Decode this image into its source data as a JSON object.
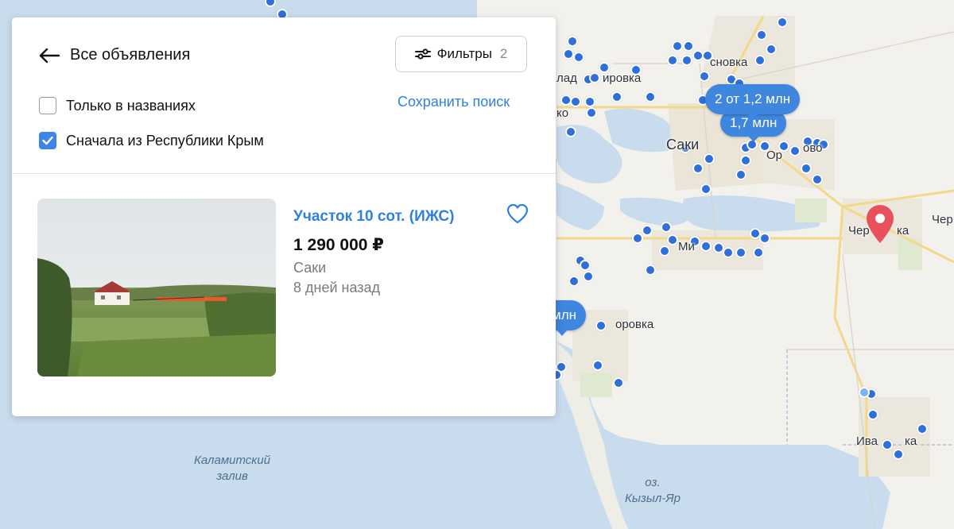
{
  "panel": {
    "back_label": "Все объявления",
    "filters": {
      "label": "Фильтры",
      "count": "2"
    },
    "checkbox_names_only": {
      "label": "Только в названиях",
      "checked": false
    },
    "checkbox_crimea_first": {
      "label": "Сначала из Республики Крым",
      "checked": true
    },
    "save_search_label": "Сохранить поиск"
  },
  "listing": {
    "title": "Участок 10 сот. (ИЖС)",
    "price": "1 290 000 ₽",
    "location": "Саки",
    "age": "8 дней назад"
  },
  "map": {
    "labels": {
      "saki": "Саки",
      "lesnovka": "сновка",
      "vladimirovka_left": "лад",
      "vladimirovka_right": "ировка",
      "orekhovo": "Ор",
      "orekhovo_tail": "ово",
      "chernovka": "Чер",
      "chernovka_right": "ка",
      "cher_far": "Чер",
      "mikhailovka": "Ми",
      "fedorovka": "оровка",
      "ivanovka": "Ива",
      "ivanovka_tail": "ка",
      "ko": "ко"
    },
    "water": {
      "kalamit": [
        "Каламитский",
        "залив"
      ],
      "kyzyl": [
        "оз.",
        "Кызыл-Яр"
      ]
    },
    "clusters": {
      "c1": "2 от 1,2 млн",
      "c2": "1,7 млн",
      "c3": "млн"
    },
    "colors": {
      "water": "#c9dcee",
      "land": "#f3f1ec",
      "dot": "#2f6fd9",
      "pill": "#3f86de",
      "pin": "#e8505b"
    }
  }
}
